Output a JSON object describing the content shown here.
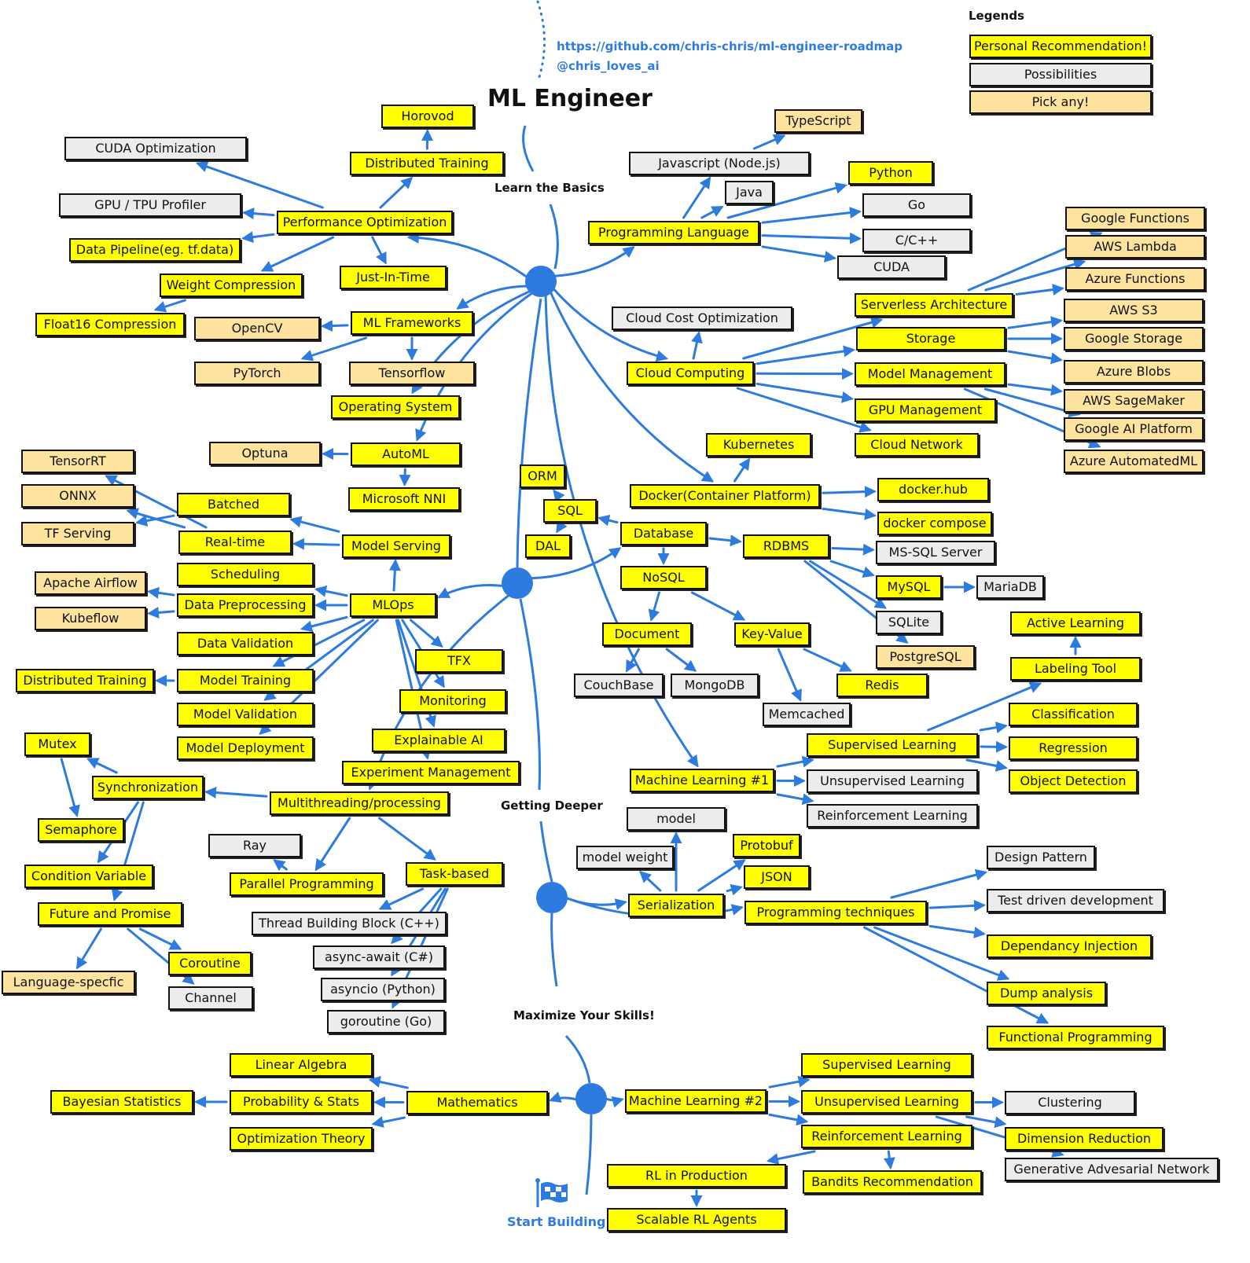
{
  "header": {
    "title": "ML Engineer",
    "repo_link": "https://github.com/chris-chris/ml-engineer-roadmap",
    "handle": "@chris_loves_ai"
  },
  "legend": {
    "title": "Legends",
    "items": [
      {
        "label": "Personal Recommendation!",
        "kind": "rec"
      },
      {
        "label": "Possibilities",
        "kind": "pos"
      },
      {
        "label": "Pick any!",
        "kind": "pick"
      }
    ]
  },
  "colors": {
    "recommendation": "#ffff00",
    "possibility": "#ececec",
    "pick_any": "#fde39e",
    "accent": "#2e7be0"
  },
  "stages": {
    "learn_basics": "Learn the Basics",
    "getting_deeper": "Getting Deeper",
    "maximize_skills": "Maximize Your Skills!",
    "start_building": "Start Building"
  },
  "start_icon": "checkered-flag-icon",
  "nodes": {
    "horovod": {
      "label": "Horovod",
      "kind": "rec"
    },
    "distributed_training_1": {
      "label": "Distributed Training",
      "kind": "rec"
    },
    "cuda_opt": {
      "label": "CUDA Optimization",
      "kind": "pos"
    },
    "gpu_profiler": {
      "label": "GPU / TPU Profiler",
      "kind": "pos"
    },
    "perf_opt": {
      "label": "Performance Optimization",
      "kind": "rec"
    },
    "data_pipeline": {
      "label": "Data Pipeline(eg. tf.data)",
      "kind": "rec"
    },
    "weight_comp": {
      "label": "Weight Compression",
      "kind": "rec"
    },
    "jit": {
      "label": "Just-In-Time",
      "kind": "rec"
    },
    "float16": {
      "label": "Float16 Compression",
      "kind": "rec"
    },
    "opencv": {
      "label": "OpenCV",
      "kind": "pick"
    },
    "ml_frameworks": {
      "label": "ML Frameworks",
      "kind": "rec"
    },
    "pytorch": {
      "label": "PyTorch",
      "kind": "pick"
    },
    "tensorflow": {
      "label": "Tensorflow",
      "kind": "pick"
    },
    "os": {
      "label": "Operating System",
      "kind": "rec"
    },
    "typescript": {
      "label": "TypeScript",
      "kind": "pick"
    },
    "javascript": {
      "label": "Javascript (Node.js)",
      "kind": "pos"
    },
    "java": {
      "label": "Java",
      "kind": "pos"
    },
    "prog_lang": {
      "label": "Programming Language",
      "kind": "rec"
    },
    "python": {
      "label": "Python",
      "kind": "rec"
    },
    "go": {
      "label": "Go",
      "kind": "pos"
    },
    "cpp": {
      "label": "C/C++",
      "kind": "pos"
    },
    "cuda": {
      "label": "CUDA",
      "kind": "pos"
    },
    "google_functions": {
      "label": "Google Functions",
      "kind": "pick"
    },
    "aws_lambda": {
      "label": "AWS Lambda",
      "kind": "pick"
    },
    "azure_functions": {
      "label": "Azure Functions",
      "kind": "pick"
    },
    "serverless": {
      "label": "Serverless Architecture",
      "kind": "rec"
    },
    "aws_s3": {
      "label": "AWS S3",
      "kind": "pick"
    },
    "cloud_cost": {
      "label": "Cloud Cost Optimization",
      "kind": "pos"
    },
    "storage": {
      "label": "Storage",
      "kind": "rec"
    },
    "google_storage": {
      "label": "Google Storage",
      "kind": "pick"
    },
    "azure_blobs": {
      "label": "Azure Blobs",
      "kind": "pick"
    },
    "cloud_computing": {
      "label": "Cloud Computing",
      "kind": "rec"
    },
    "model_mgmt": {
      "label": "Model Management",
      "kind": "rec"
    },
    "aws_sagemaker": {
      "label": "AWS SageMaker",
      "kind": "pick"
    },
    "gpu_mgmt": {
      "label": "GPU Management",
      "kind": "rec"
    },
    "google_ai": {
      "label": "Google AI Platform",
      "kind": "pick"
    },
    "cloud_network": {
      "label": "Cloud Network",
      "kind": "rec"
    },
    "azure_automl": {
      "label": "Azure AutomatedML",
      "kind": "pick"
    },
    "kubernetes": {
      "label": "Kubernetes",
      "kind": "rec"
    },
    "docker": {
      "label": "Docker(Container Platform)",
      "kind": "rec"
    },
    "dockerhub": {
      "label": "docker.hub",
      "kind": "rec"
    },
    "docker_compose": {
      "label": "docker compose",
      "kind": "rec"
    },
    "orm": {
      "label": "ORM",
      "kind": "rec"
    },
    "sql": {
      "label": "SQL",
      "kind": "rec"
    },
    "dal": {
      "label": "DAL",
      "kind": "rec"
    },
    "database": {
      "label": "Database",
      "kind": "rec"
    },
    "rdbms": {
      "label": "RDBMS",
      "kind": "rec"
    },
    "mssql": {
      "label": "MS-SQL Server",
      "kind": "pos"
    },
    "nosql": {
      "label": "NoSQL",
      "kind": "rec"
    },
    "mysql": {
      "label": "MySQL",
      "kind": "rec"
    },
    "mariadb": {
      "label": "MariaDB",
      "kind": "pos"
    },
    "document": {
      "label": "Document",
      "kind": "rec"
    },
    "keyvalue": {
      "label": "Key-Value",
      "kind": "rec"
    },
    "sqlite": {
      "label": "SQLite",
      "kind": "pos"
    },
    "postgresql": {
      "label": "PostgreSQL",
      "kind": "pick"
    },
    "couchbase": {
      "label": "CouchBase",
      "kind": "pos"
    },
    "mongodb": {
      "label": "MongoDB",
      "kind": "pos"
    },
    "redis": {
      "label": "Redis",
      "kind": "rec"
    },
    "memcached": {
      "label": "Memcached",
      "kind": "pos"
    },
    "active_learning": {
      "label": "Active Learning",
      "kind": "rec"
    },
    "labeling_tool": {
      "label": "Labeling Tool",
      "kind": "rec"
    },
    "classification": {
      "label": "Classification",
      "kind": "rec"
    },
    "regression": {
      "label": "Regression",
      "kind": "rec"
    },
    "object_detection": {
      "label": "Object Detection",
      "kind": "rec"
    },
    "supervised_1": {
      "label": "Supervised Learning",
      "kind": "rec"
    },
    "unsupervised_1": {
      "label": "Unsupervised Learning",
      "kind": "pos"
    },
    "reinforcement_1": {
      "label": "Reinforcement Learning",
      "kind": "pos"
    },
    "ml1": {
      "label": "Machine Learning #1",
      "kind": "rec"
    },
    "optuna": {
      "label": "Optuna",
      "kind": "pick"
    },
    "automl": {
      "label": "AutoML",
      "kind": "rec"
    },
    "nni": {
      "label": "Microsoft NNI",
      "kind": "rec"
    },
    "tensorrt": {
      "label": "TensorRT",
      "kind": "pick"
    },
    "onnx": {
      "label": "ONNX",
      "kind": "pick"
    },
    "tf_serving": {
      "label": "TF Serving",
      "kind": "pick"
    },
    "batched": {
      "label": "Batched",
      "kind": "rec"
    },
    "realtime": {
      "label": "Real-time",
      "kind": "rec"
    },
    "model_serving": {
      "label": "Model Serving",
      "kind": "rec"
    },
    "scheduling": {
      "label": "Scheduling",
      "kind": "rec"
    },
    "airflow": {
      "label": "Apache Airflow",
      "kind": "pick"
    },
    "kubeflow": {
      "label": "Kubeflow",
      "kind": "pick"
    },
    "data_prep": {
      "label": "Data Preprocessing",
      "kind": "rec"
    },
    "mlops": {
      "label": "MLOps",
      "kind": "rec"
    },
    "data_validation": {
      "label": "Data Validation",
      "kind": "rec"
    },
    "tfx": {
      "label": "TFX",
      "kind": "rec"
    },
    "distributed_training_2": {
      "label": "Distributed Training",
      "kind": "rec"
    },
    "model_training": {
      "label": "Model Training",
      "kind": "rec"
    },
    "monitoring": {
      "label": "Monitoring",
      "kind": "rec"
    },
    "model_validation": {
      "label": "Model Validation",
      "kind": "rec"
    },
    "explainable_ai": {
      "label": "Explainable AI",
      "kind": "rec"
    },
    "model_deployment": {
      "label": "Model Deployment",
      "kind": "rec"
    },
    "experiment_mgmt": {
      "label": "Experiment Management",
      "kind": "rec"
    },
    "mutex": {
      "label": "Mutex",
      "kind": "rec"
    },
    "synchronization": {
      "label": "Synchronization",
      "kind": "rec"
    },
    "multithreading": {
      "label": "Multithreading/processing",
      "kind": "rec"
    },
    "semaphore": {
      "label": "Semaphore",
      "kind": "rec"
    },
    "ray": {
      "label": "Ray",
      "kind": "pos"
    },
    "condition_variable": {
      "label": "Condition Variable",
      "kind": "rec"
    },
    "parallel_prog": {
      "label": "Parallel Programming",
      "kind": "rec"
    },
    "task_based": {
      "label": "Task-based",
      "kind": "rec"
    },
    "future_promise": {
      "label": "Future and Promise",
      "kind": "rec"
    },
    "tbb": {
      "label": "Thread Building Block (C++)",
      "kind": "pos"
    },
    "coroutine": {
      "label": "Coroutine",
      "kind": "rec"
    },
    "async_await": {
      "label": "async-await (C#)",
      "kind": "pos"
    },
    "language_specific": {
      "label": "Language-specfic",
      "kind": "pick"
    },
    "channel": {
      "label": "Channel",
      "kind": "pos"
    },
    "asyncio": {
      "label": "asyncio (Python)",
      "kind": "pos"
    },
    "goroutine": {
      "label": "goroutine (Go)",
      "kind": "pos"
    },
    "model": {
      "label": "model",
      "kind": "pos"
    },
    "model_weight": {
      "label": "model weight",
      "kind": "pos"
    },
    "protobuf": {
      "label": "Protobuf",
      "kind": "rec"
    },
    "json": {
      "label": "JSON",
      "kind": "rec"
    },
    "serialization": {
      "label": "Serialization",
      "kind": "rec"
    },
    "prog_techniques": {
      "label": "Programming techniques",
      "kind": "rec"
    },
    "design_pattern": {
      "label": "Design Pattern",
      "kind": "pos"
    },
    "tdd": {
      "label": "Test driven development",
      "kind": "pos"
    },
    "di": {
      "label": "Dependancy Injection",
      "kind": "rec"
    },
    "dump_analysis": {
      "label": "Dump analysis",
      "kind": "rec"
    },
    "functional_prog": {
      "label": "Functional Programming",
      "kind": "rec"
    },
    "linear_algebra": {
      "label": "Linear Algebra",
      "kind": "rec"
    },
    "bayesian": {
      "label": "Bayesian Statistics",
      "kind": "rec"
    },
    "prob_stats": {
      "label": "Probability & Stats",
      "kind": "rec"
    },
    "mathematics": {
      "label": "Mathematics",
      "kind": "rec"
    },
    "optimization_theory": {
      "label": "Optimization Theory",
      "kind": "rec"
    },
    "ml2": {
      "label": "Machine Learning #2",
      "kind": "rec"
    },
    "supervised_2": {
      "label": "Supervised Learning",
      "kind": "rec"
    },
    "unsupervised_2": {
      "label": "Unsupervised Learning",
      "kind": "rec"
    },
    "reinforcement_2": {
      "label": "Reinforcement Learning",
      "kind": "rec"
    },
    "clustering": {
      "label": "Clustering",
      "kind": "pos"
    },
    "dimension_reduction": {
      "label": "Dimension Reduction",
      "kind": "rec"
    },
    "gan": {
      "label": "Generative Advesarial Network",
      "kind": "pos"
    },
    "rl_production": {
      "label": "RL in Production",
      "kind": "rec"
    },
    "bandits": {
      "label": "Bandits Recommendation",
      "kind": "rec"
    },
    "scalable_rl": {
      "label": "Scalable RL Agents",
      "kind": "rec"
    }
  },
  "edges": [
    [
      "hub1",
      "perf_opt"
    ],
    [
      "hub1",
      "ml_frameworks"
    ],
    [
      "hub1",
      "os"
    ],
    [
      "hub1",
      "automl"
    ],
    [
      "hub1",
      "prog_lang"
    ],
    [
      "hub1",
      "cloud_computing"
    ],
    [
      "hub1",
      "docker"
    ],
    [
      "hub1",
      "ml1"
    ],
    [
      "perf_opt",
      "distributed_training_1"
    ],
    [
      "distributed_training_1",
      "horovod"
    ],
    [
      "perf_opt",
      "cuda_opt"
    ],
    [
      "perf_opt",
      "gpu_profiler"
    ],
    [
      "perf_opt",
      "data_pipeline"
    ],
    [
      "perf_opt",
      "weight_comp"
    ],
    [
      "perf_opt",
      "jit"
    ],
    [
      "weight_comp",
      "float16"
    ],
    [
      "ml_frameworks",
      "opencv"
    ],
    [
      "ml_frameworks",
      "pytorch"
    ],
    [
      "ml_frameworks",
      "tensorflow"
    ],
    [
      "prog_lang",
      "javascript"
    ],
    [
      "prog_lang",
      "java"
    ],
    [
      "javascript",
      "typescript"
    ],
    [
      "prog_lang",
      "python"
    ],
    [
      "prog_lang",
      "go"
    ],
    [
      "prog_lang",
      "cpp"
    ],
    [
      "prog_lang",
      "cuda"
    ],
    [
      "cloud_computing",
      "cloud_cost"
    ],
    [
      "cloud_computing",
      "serverless"
    ],
    [
      "cloud_computing",
      "storage"
    ],
    [
      "cloud_computing",
      "model_mgmt"
    ],
    [
      "cloud_computing",
      "gpu_mgmt"
    ],
    [
      "cloud_computing",
      "cloud_network"
    ],
    [
      "serverless",
      "google_functions"
    ],
    [
      "serverless",
      "aws_lambda"
    ],
    [
      "serverless",
      "azure_functions"
    ],
    [
      "storage",
      "aws_s3"
    ],
    [
      "storage",
      "google_storage"
    ],
    [
      "storage",
      "azure_blobs"
    ],
    [
      "model_mgmt",
      "aws_sagemaker"
    ],
    [
      "model_mgmt",
      "google_ai"
    ],
    [
      "model_mgmt",
      "azure_automl"
    ],
    [
      "docker",
      "kubernetes"
    ],
    [
      "docker",
      "dockerhub"
    ],
    [
      "docker",
      "docker_compose"
    ],
    [
      "automl",
      "optuna"
    ],
    [
      "automl",
      "nni"
    ],
    [
      "hub2",
      "mlops"
    ],
    [
      "hub2",
      "database"
    ],
    [
      "hub2",
      "multithreading"
    ],
    [
      "database",
      "sql"
    ],
    [
      "sql",
      "orm"
    ],
    [
      "sql",
      "dal"
    ],
    [
      "database",
      "rdbms"
    ],
    [
      "database",
      "nosql"
    ],
    [
      "rdbms",
      "mssql"
    ],
    [
      "rdbms",
      "mysql"
    ],
    [
      "mysql",
      "mariadb"
    ],
    [
      "rdbms",
      "sqlite"
    ],
    [
      "rdbms",
      "postgresql"
    ],
    [
      "nosql",
      "document"
    ],
    [
      "nosql",
      "keyvalue"
    ],
    [
      "document",
      "couchbase"
    ],
    [
      "document",
      "mongodb"
    ],
    [
      "keyvalue",
      "memcached"
    ],
    [
      "keyvalue",
      "redis"
    ],
    [
      "ml1",
      "supervised_1"
    ],
    [
      "ml1",
      "unsupervised_1"
    ],
    [
      "ml1",
      "reinforcement_1"
    ],
    [
      "supervised_1",
      "labeling_tool"
    ],
    [
      "labeling_tool",
      "active_learning"
    ],
    [
      "supervised_1",
      "classification"
    ],
    [
      "supervised_1",
      "regression"
    ],
    [
      "supervised_1",
      "object_detection"
    ],
    [
      "mlops",
      "model_serving"
    ],
    [
      "model_serving",
      "batched"
    ],
    [
      "model_serving",
      "realtime"
    ],
    [
      "batched",
      "tf_serving"
    ],
    [
      "realtime",
      "tensorrt"
    ],
    [
      "realtime",
      "onnx"
    ],
    [
      "mlops",
      "scheduling"
    ],
    [
      "mlops",
      "data_prep"
    ],
    [
      "data_prep",
      "airflow"
    ],
    [
      "data_prep",
      "kubeflow"
    ],
    [
      "mlops",
      "data_validation"
    ],
    [
      "mlops",
      "model_training"
    ],
    [
      "model_training",
      "distributed_training_2"
    ],
    [
      "mlops",
      "model_validation"
    ],
    [
      "mlops",
      "model_deployment"
    ],
    [
      "mlops",
      "experiment_mgmt"
    ],
    [
      "mlops",
      "explainable_ai"
    ],
    [
      "mlops",
      "monitoring"
    ],
    [
      "mlops",
      "tfx"
    ],
    [
      "multithreading",
      "synchronization"
    ],
    [
      "synchronization",
      "mutex"
    ],
    [
      "mutex",
      "semaphore"
    ],
    [
      "synchronization",
      "condition_variable"
    ],
    [
      "synchronization",
      "future_promise"
    ],
    [
      "future_promise",
      "language_specific"
    ],
    [
      "future_promise",
      "coroutine"
    ],
    [
      "future_promise",
      "channel"
    ],
    [
      "multithreading",
      "parallel_prog"
    ],
    [
      "parallel_prog",
      "ray"
    ],
    [
      "multithreading",
      "task_based"
    ],
    [
      "task_based",
      "tbb"
    ],
    [
      "task_based",
      "async_await"
    ],
    [
      "task_based",
      "asyncio"
    ],
    [
      "task_based",
      "goroutine"
    ],
    [
      "hub3",
      "serialization"
    ],
    [
      "hub3",
      "prog_techniques"
    ],
    [
      "serialization",
      "model"
    ],
    [
      "serialization",
      "model_weight"
    ],
    [
      "serialization",
      "protobuf"
    ],
    [
      "serialization",
      "json"
    ],
    [
      "prog_techniques",
      "design_pattern"
    ],
    [
      "prog_techniques",
      "tdd"
    ],
    [
      "prog_techniques",
      "di"
    ],
    [
      "prog_techniques",
      "dump_analysis"
    ],
    [
      "prog_techniques",
      "functional_prog"
    ],
    [
      "hub4",
      "mathematics"
    ],
    [
      "hub4",
      "ml2"
    ],
    [
      "mathematics",
      "linear_algebra"
    ],
    [
      "mathematics",
      "prob_stats"
    ],
    [
      "mathematics",
      "optimization_theory"
    ],
    [
      "prob_stats",
      "bayesian"
    ],
    [
      "ml2",
      "supervised_2"
    ],
    [
      "ml2",
      "unsupervised_2"
    ],
    [
      "ml2",
      "reinforcement_2"
    ],
    [
      "unsupervised_2",
      "clustering"
    ],
    [
      "unsupervised_2",
      "dimension_reduction"
    ],
    [
      "unsupervised_2",
      "gan"
    ],
    [
      "reinforcement_2",
      "rl_production"
    ],
    [
      "reinforcement_2",
      "bandits"
    ],
    [
      "rl_production",
      "scalable_rl"
    ]
  ]
}
